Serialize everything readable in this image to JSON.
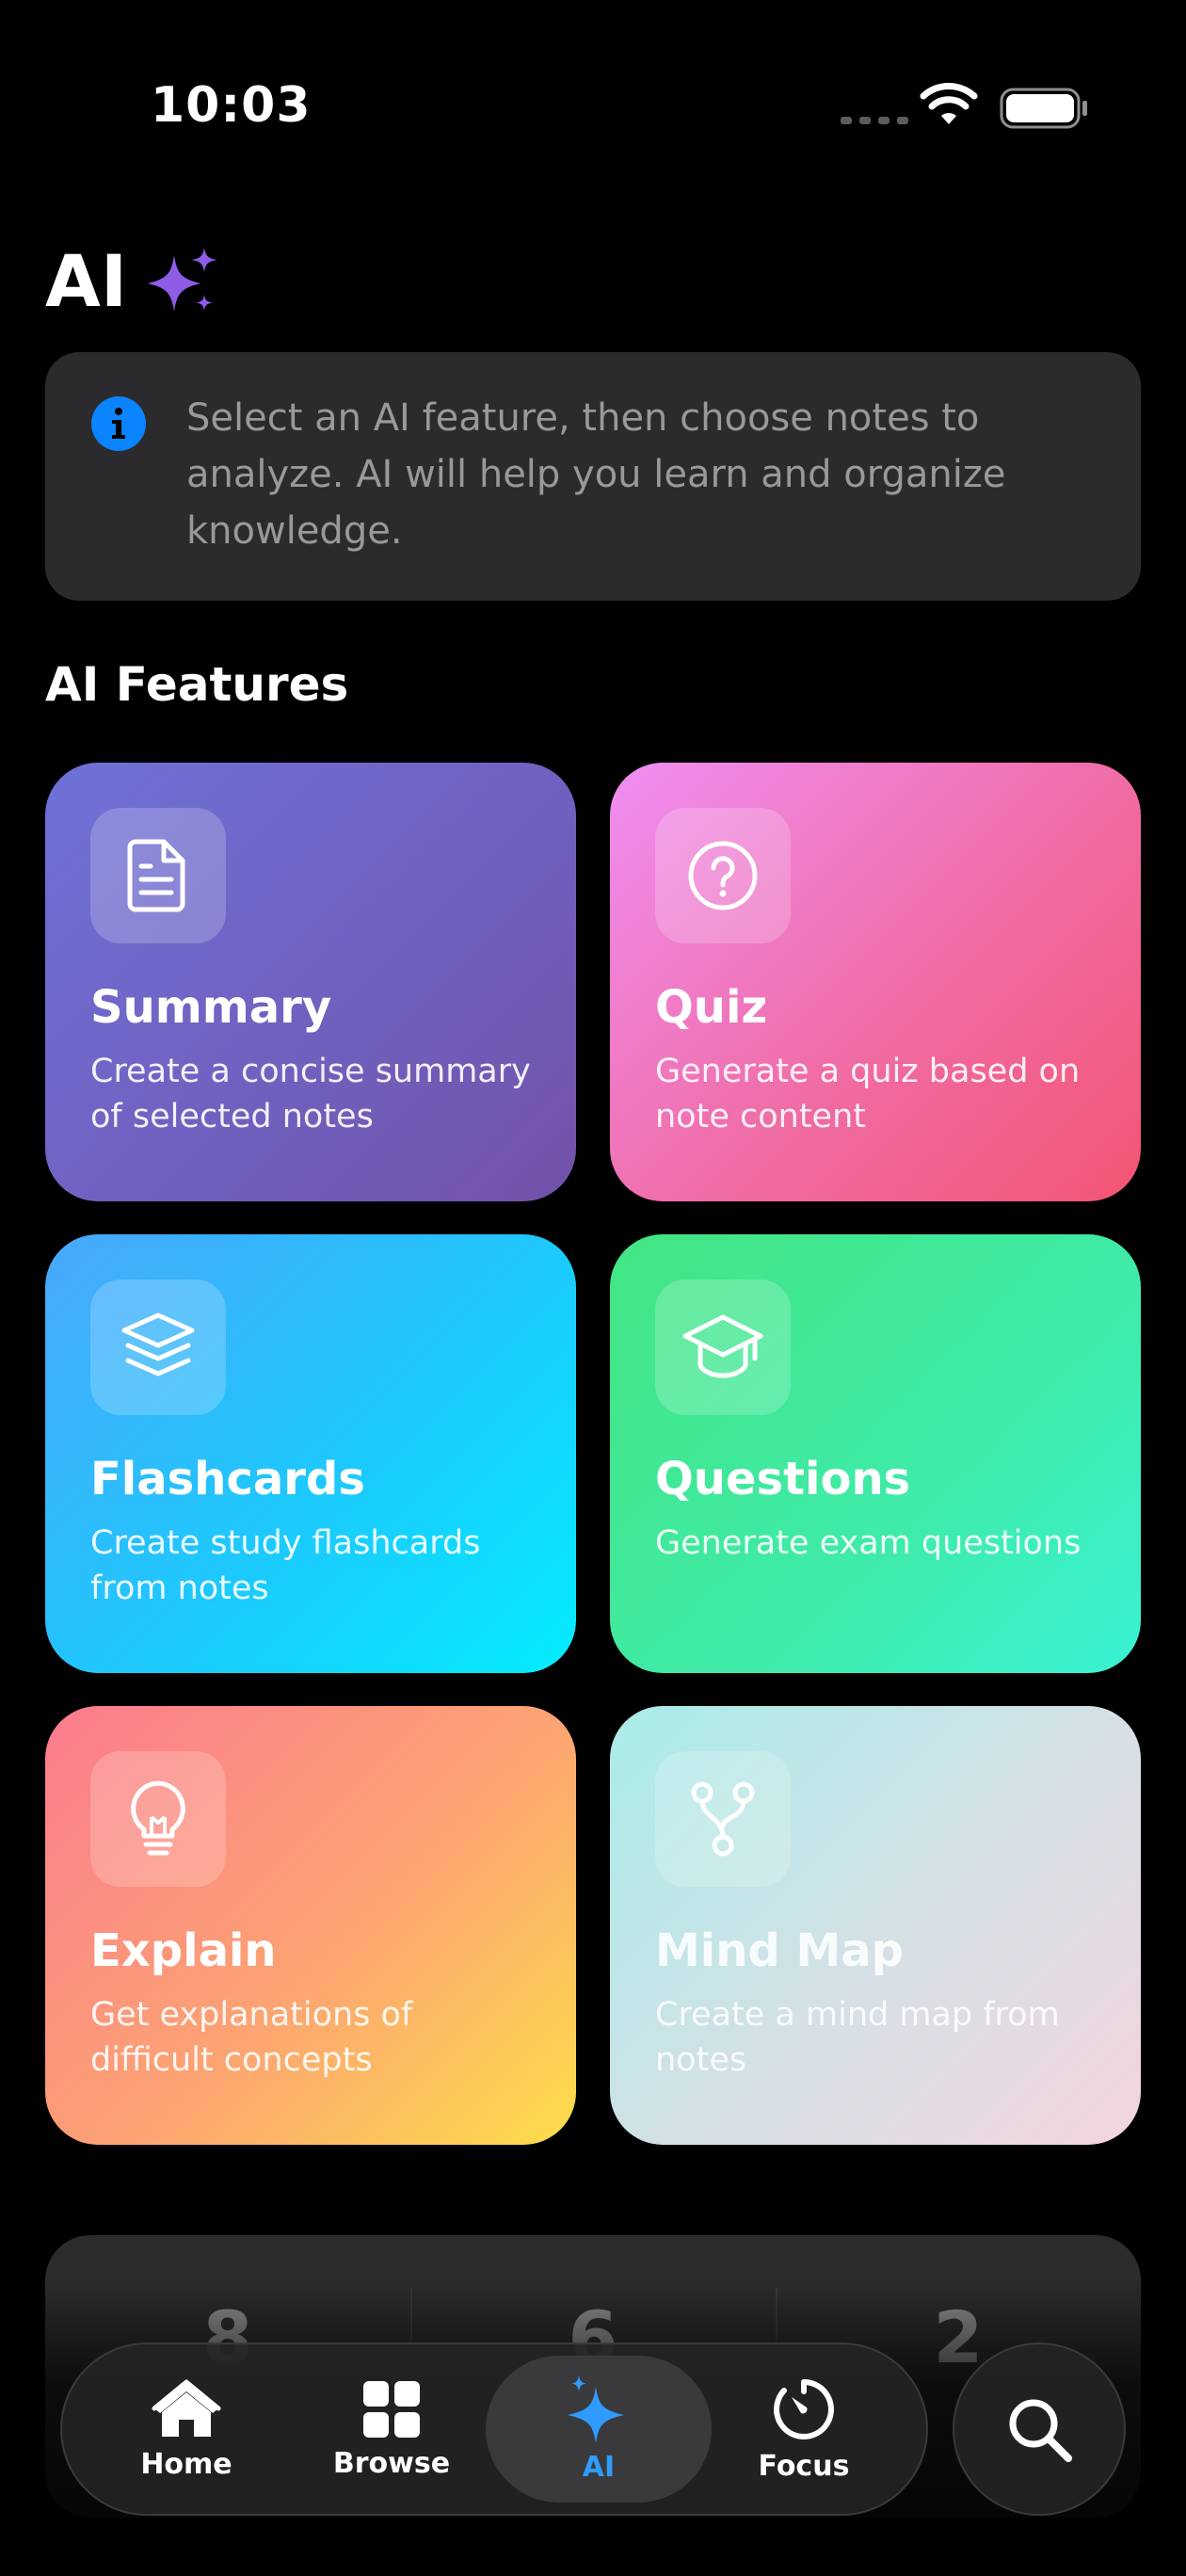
{
  "status_bar": {
    "time": "10:03"
  },
  "header": {
    "title": "AI"
  },
  "info": {
    "text": "Select an AI feature, then choose notes to analyze. AI will help you learn and organize knowledge."
  },
  "section": {
    "title": "AI Features"
  },
  "features": [
    {
      "title": "Summary",
      "description": "Create a concise summary of selected notes",
      "icon": "document-icon"
    },
    {
      "title": "Quiz",
      "description": "Generate a quiz based on note content",
      "icon": "question-circle-icon"
    },
    {
      "title": "Flashcards",
      "description": "Create study flashcards from notes",
      "icon": "stack-icon"
    },
    {
      "title": "Questions",
      "description": "Generate exam questions",
      "icon": "graduation-cap-icon"
    },
    {
      "title": "Explain",
      "description": "Get explanations of difficult concepts",
      "icon": "lightbulb-icon"
    },
    {
      "title": "Mind Map",
      "description": "Create a mind map from notes",
      "icon": "branch-icon"
    }
  ],
  "stats": [
    {
      "value": "8"
    },
    {
      "value": "6"
    },
    {
      "value": "2"
    }
  ],
  "tab_bar": {
    "tabs": [
      {
        "label": "Home",
        "icon": "house-icon"
      },
      {
        "label": "Browse",
        "icon": "grid-icon"
      },
      {
        "label": "AI",
        "icon": "sparkles-icon",
        "active": true
      },
      {
        "label": "Focus",
        "icon": "timer-icon"
      }
    ],
    "search_icon": "search-icon"
  },
  "colors": {
    "accent": "#2f9bff",
    "summary": "#6e72d8",
    "quiz": "#f06ca5",
    "flashcards": "#1cc9fd",
    "questions": "#3eeba9",
    "explain": "#fca472",
    "mind_map": "#d6e0e6"
  }
}
